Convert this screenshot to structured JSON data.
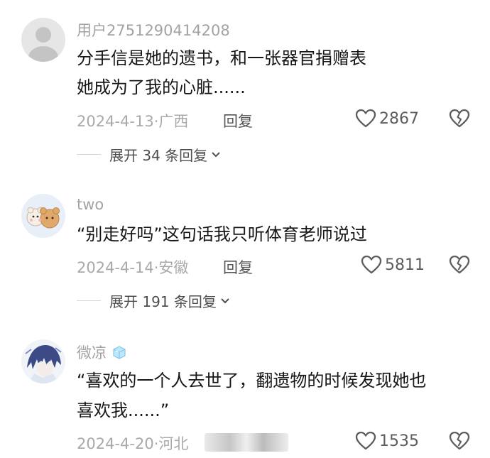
{
  "comments": [
    {
      "username": "用户2751290414208",
      "lines": [
        "分手信是她的遗书，和一张器官捐赠表",
        "她成为了我的心脏......"
      ],
      "date": "2024-4-13",
      "location": "广西",
      "reply_label": "回复",
      "likes": "2867",
      "expand_label": "展开 34 条回复",
      "avatar_icon": "default-user-avatar"
    },
    {
      "username": "two",
      "lines": [
        "“别走好吗”这句话我只听体育老师说过"
      ],
      "date": "2024-4-14",
      "location": "安徽",
      "reply_label": "回复",
      "likes": "5811",
      "expand_label": "展开 191 条回复",
      "avatar_icon": "cartoon-bear-avatar"
    },
    {
      "username": "微凉",
      "lines": [
        "“喜欢的一个人去世了，翻遗物的时候发现她也",
        "喜欢我......”"
      ],
      "date": "2024-4-20",
      "location": "河北",
      "likes": "1535",
      "avatar_icon": "anime-character-avatar",
      "badge_icon": "ice-cube-icon"
    }
  ],
  "colors": {
    "text": "#161616",
    "muted": "#a3a3a3",
    "icon": "#5c5c5c"
  }
}
